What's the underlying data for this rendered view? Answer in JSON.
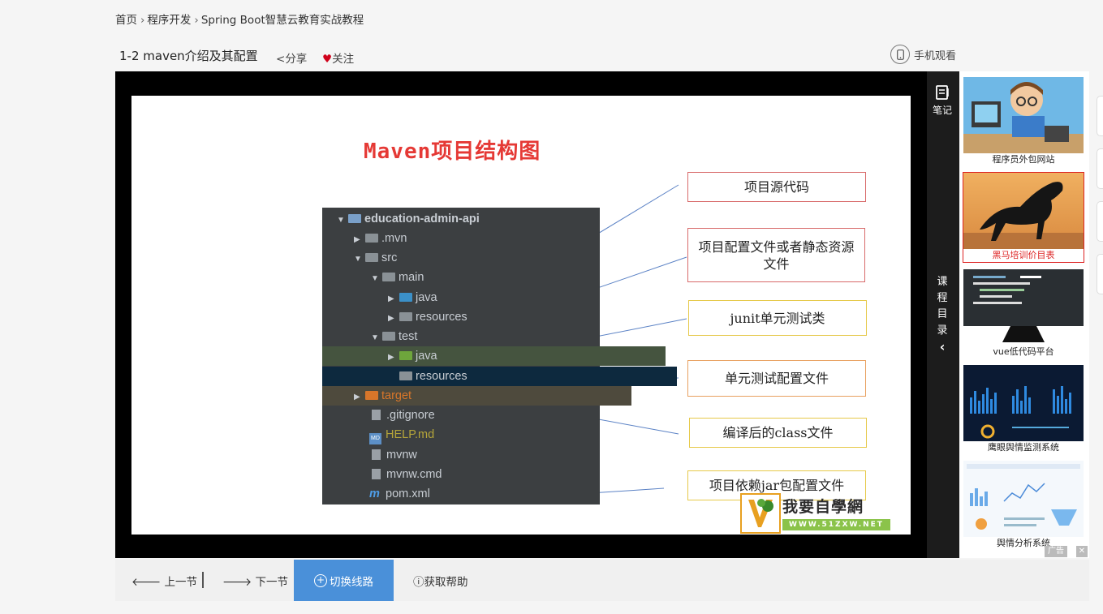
{
  "breadcrumb": [
    "首页",
    "程序开发",
    "Spring Boot智慧云教育实战教程"
  ],
  "header": {
    "title": "1-2 maven介绍及其配置",
    "share": "分享",
    "follow": "关注",
    "mobile": "手机观看"
  },
  "slide": {
    "title": "Maven项目结构图",
    "tree": [
      {
        "label": "education-admin-api"
      },
      {
        "label": ".mvn"
      },
      {
        "label": "src"
      },
      {
        "label": "main"
      },
      {
        "label": "java"
      },
      {
        "label": "resources"
      },
      {
        "label": "test"
      },
      {
        "label": "java"
      },
      {
        "label": "resources"
      },
      {
        "label": "target"
      },
      {
        "label": ".gitignore"
      },
      {
        "label": "HELP.md"
      },
      {
        "label": "mvnw"
      },
      {
        "label": "mvnw.cmd"
      },
      {
        "label": "pom.xml"
      }
    ],
    "callouts": [
      "项目源代码",
      "项目配置文件或者静态资源文件",
      "junit单元测试类",
      "单元测试配置文件",
      "编译后的class文件",
      "项目依赖jar包配置文件"
    ],
    "watermark": {
      "name": "我要自學網",
      "url": "WWW.51ZXW.NET"
    }
  },
  "side": {
    "notes": "笔记",
    "catalog": [
      "课",
      "程",
      "目",
      "录"
    ]
  },
  "ads": [
    {
      "caption": "程序员外包网站"
    },
    {
      "caption": "黑马培训价目表"
    },
    {
      "caption": "vue低代码平台"
    },
    {
      "caption": "鹰眼舆情监测系统"
    },
    {
      "caption": "舆情分析系统"
    }
  ],
  "ad_badge": "广告",
  "controls": {
    "prev": "上一节",
    "next": "下一节",
    "switch": "切换线路",
    "help": "获取帮助"
  },
  "colors": {
    "accent": "#4a90d9",
    "slide_title": "#e53935",
    "heart": "#d0021b"
  }
}
